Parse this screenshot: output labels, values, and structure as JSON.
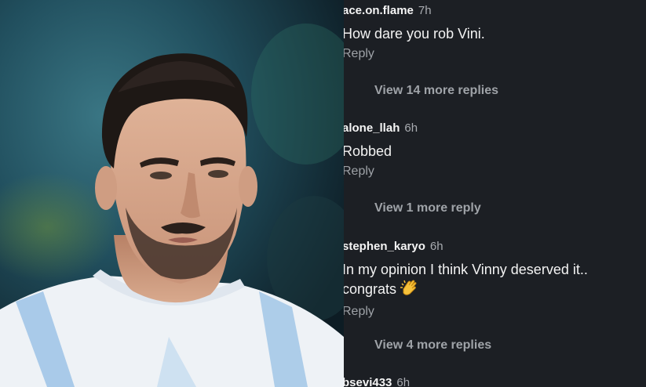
{
  "comments": [
    {
      "username": "ace.on.flame",
      "time": "7h",
      "text": "How dare you rob Vini.",
      "reply_label": "Reply",
      "view_more": "View 14 more replies"
    },
    {
      "username": "alone_llah",
      "time": "6h",
      "text": "Robbed",
      "reply_label": "Reply",
      "view_more": "View 1 more reply"
    },
    {
      "username": "stephen_karyo",
      "time": "6h",
      "text_line1": "In my opinion I think Vinny deserved it..",
      "text_line2": "congrats",
      "emoji": "clapping-hands-icon",
      "reply_label": "Reply",
      "view_more": "View 4 more replies"
    },
    {
      "username": "bsevi433",
      "time": "6h"
    }
  ],
  "colors": {
    "panel_bg": "#1c1f24",
    "text": "#f3f3f3",
    "muted": "#9ea2a7"
  }
}
